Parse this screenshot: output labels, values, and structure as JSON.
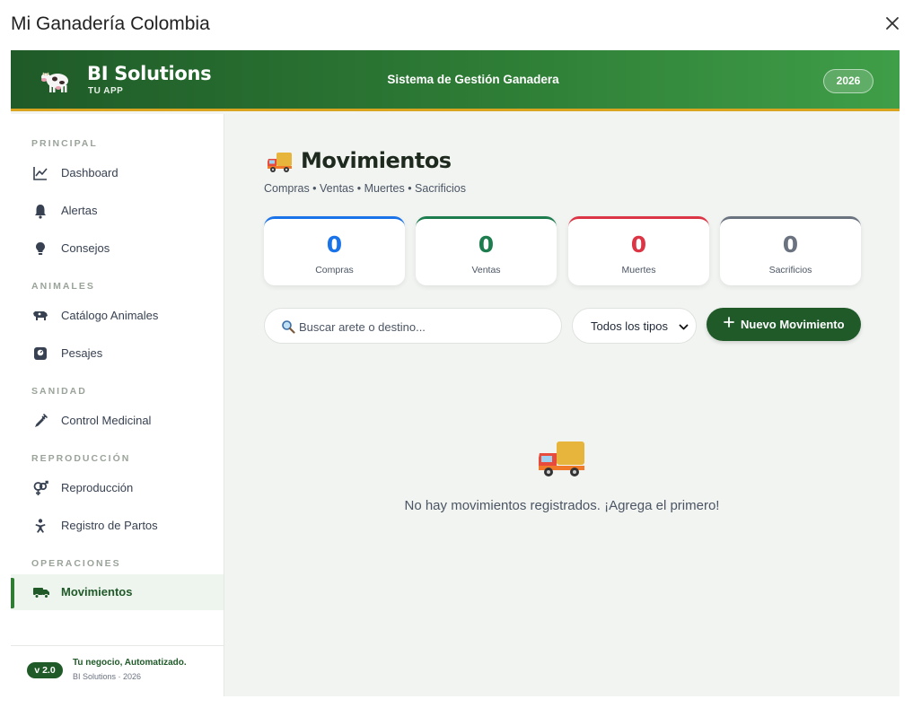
{
  "window": {
    "title": "Mi Ganadería Colombia"
  },
  "header": {
    "brand_name": "BI Solutions",
    "brand_sub": "TU APP",
    "system_title": "Sistema de Gestión Ganadera",
    "year": "2026"
  },
  "sidebar": {
    "sections": {
      "principal": "PRINCIPAL",
      "animales": "ANIMALES",
      "sanidad": "SANIDAD",
      "reproduccion": "REPRODUCCIÓN",
      "operaciones": "OPERACIONES"
    },
    "items": {
      "dashboard": "Dashboard",
      "alertas": "Alertas",
      "consejos": "Consejos",
      "catalogo": "Catálogo Animales",
      "pesajes": "Pesajes",
      "control_medicinal": "Control Medicinal",
      "reproduccion": "Reproducción",
      "registro_partos": "Registro de Partos",
      "movimientos": "Movimientos"
    },
    "active_item": "movimientos",
    "footer": {
      "version": "v 2.0",
      "tagline": "Tu negocio, Automatizado.",
      "credit": "BI Solutions · 2026"
    }
  },
  "main": {
    "title": "Movimientos",
    "subtitle": "Compras • Ventas • Muertes • Sacrificios",
    "stats": [
      {
        "value": "0",
        "label": "Compras",
        "color": "#1a73e8"
      },
      {
        "value": "0",
        "label": "Ventas",
        "color": "#1e7d4f"
      },
      {
        "value": "0",
        "label": "Muertes",
        "color": "#dc3545"
      },
      {
        "value": "0",
        "label": "Sacrificios",
        "color": "#6b7280"
      }
    ],
    "search_placeholder": "Buscar arete o destino...",
    "type_filter": "Todos los tipos",
    "new_button": "Nuevo Movimiento",
    "empty_message": "No hay movimientos registrados. ¡Agrega el primero!"
  }
}
